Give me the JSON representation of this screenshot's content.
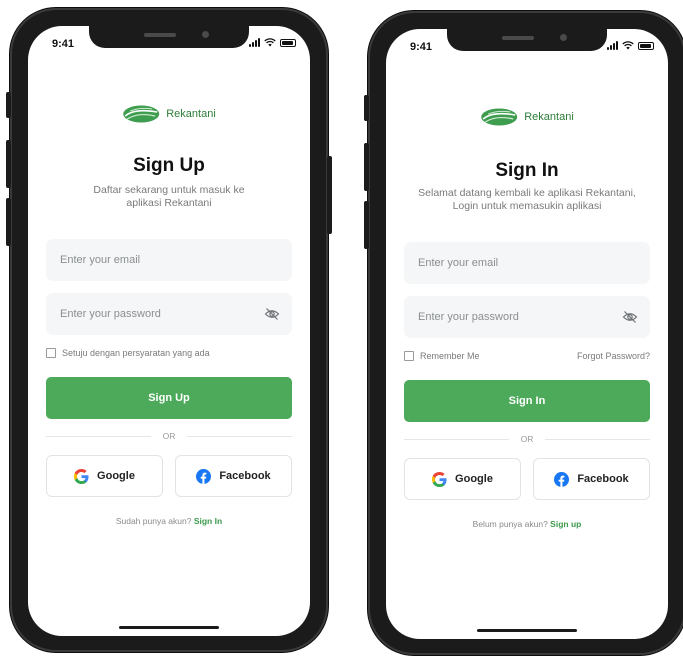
{
  "status": {
    "time": "9:41"
  },
  "brand": {
    "name": "Rekantani",
    "color": "#2e7d3a"
  },
  "colors": {
    "primary": "#4caa5a",
    "link": "#3c9a4a"
  },
  "signup": {
    "title": "Sign Up",
    "subtitle_line1": "Daftar sekarang untuk masuk ke",
    "subtitle_line2": "aplikasi Rekantani",
    "email_placeholder": "Enter your email",
    "password_placeholder": "Enter your password",
    "terms_label": "Setuju dengan persyaratan yang ada",
    "submit_label": "Sign Up",
    "divider_label": "OR",
    "google_label": "Google",
    "facebook_label": "Facebook",
    "footer_text": "Sudah punya akun?",
    "footer_link": "Sign In"
  },
  "signin": {
    "title": "Sign In",
    "subtitle_line1": "Selamat datang kembali ke aplikasi Rekantani,",
    "subtitle_line2": "Login untuk memasukin aplikasi",
    "email_placeholder": "Enter your email",
    "password_placeholder": "Enter your password",
    "remember_label": "Remember Me",
    "forgot_label": "Forgot Password?",
    "submit_label": "Sign In",
    "divider_label": "OR",
    "google_label": "Google",
    "facebook_label": "Facebook",
    "footer_text": "Belum punya akun?",
    "footer_link": "Sign up"
  }
}
